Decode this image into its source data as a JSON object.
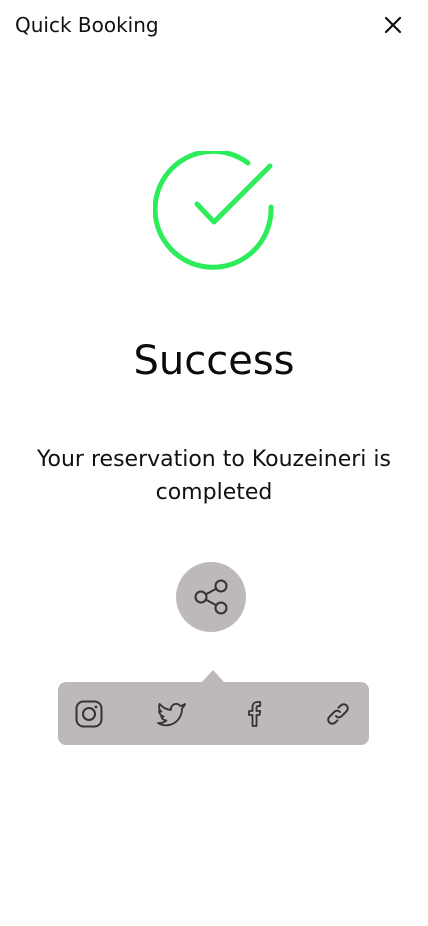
{
  "header": {
    "title": "Quick Booking",
    "close_icon": "close-icon"
  },
  "status": {
    "icon": "check-circle-icon",
    "icon_color": "#2cec5a",
    "title": "Success",
    "message": "Your reservation to Kouzeineri is completed"
  },
  "share": {
    "button_icon": "share-icon",
    "button_bg": "#bdb9b9",
    "options": [
      {
        "icon": "instagram-icon"
      },
      {
        "icon": "twitter-icon"
      },
      {
        "icon": "facebook-icon"
      },
      {
        "icon": "link-icon"
      }
    ]
  }
}
